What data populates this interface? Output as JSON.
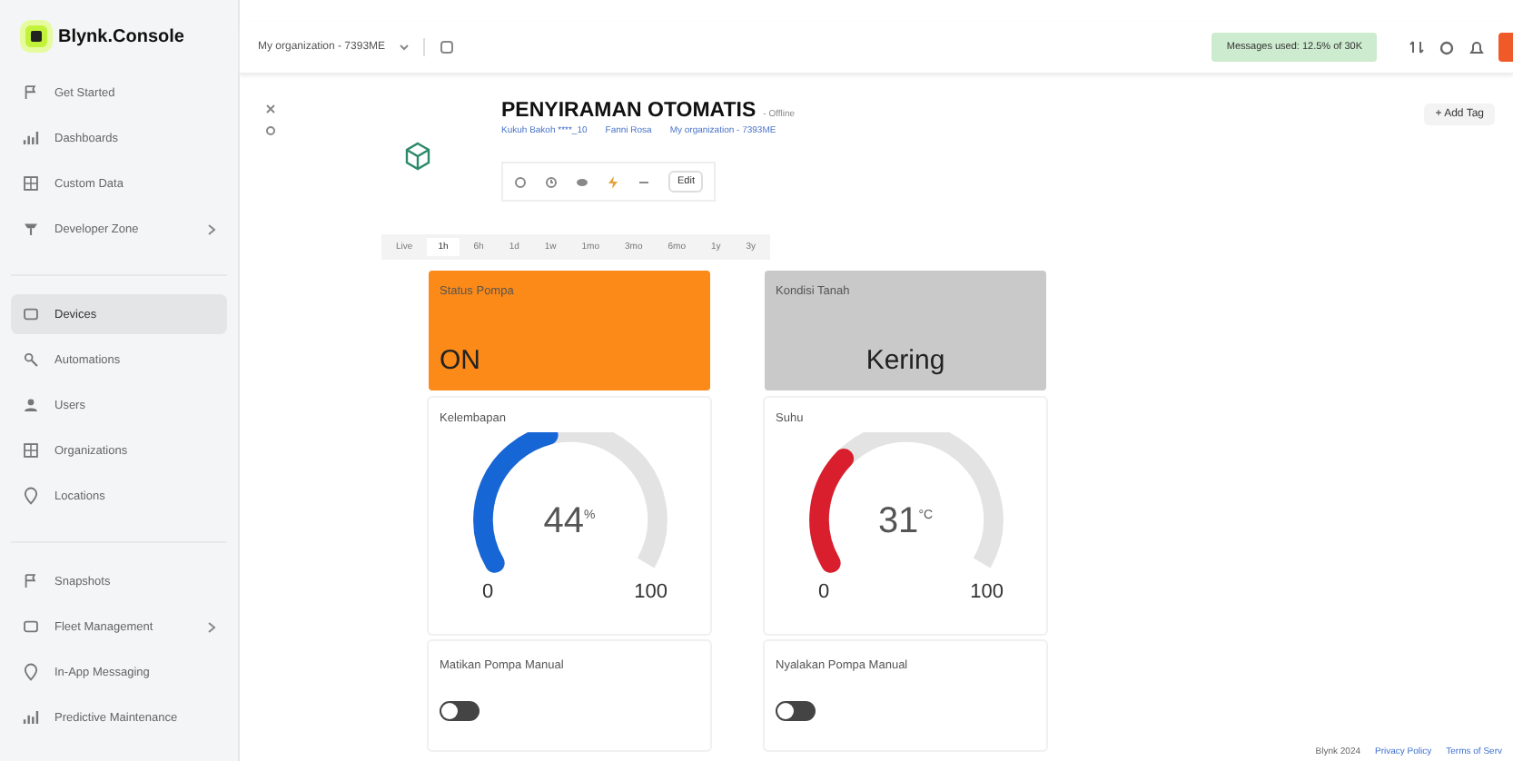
{
  "sidebar": {
    "logo": "Blynk.Console",
    "groups": [
      {
        "items": [
          {
            "label": "Get Started",
            "selected": false,
            "chevron": false
          },
          {
            "label": "Dashboards",
            "selected": false,
            "chevron": false
          },
          {
            "label": "Custom Data",
            "selected": false,
            "chevron": false
          },
          {
            "label": "Developer Zone",
            "selected": false,
            "chevron": true
          }
        ]
      },
      {
        "items": [
          {
            "label": "Devices",
            "selected": true,
            "chevron": false
          },
          {
            "label": "Automations",
            "selected": false,
            "chevron": false
          },
          {
            "label": "Users",
            "selected": false,
            "chevron": false
          },
          {
            "label": "Organizations",
            "selected": false,
            "chevron": false
          },
          {
            "label": "Locations",
            "selected": false,
            "chevron": false
          }
        ]
      },
      {
        "items": [
          {
            "label": "Snapshots",
            "selected": false,
            "chevron": false
          },
          {
            "label": "Fleet Management",
            "selected": false,
            "chevron": true
          },
          {
            "label": "In-App Messaging",
            "selected": false,
            "chevron": false
          },
          {
            "label": "Predictive Maintenance",
            "selected": false,
            "chevron": false
          }
        ]
      }
    ]
  },
  "topbar": {
    "organization": "My organization - 7393ME",
    "usage": "Messages used: 12.5% of 30K"
  },
  "device": {
    "title": "PENYIRAMAN OTOMATIS",
    "status": "- Offline",
    "meta": [
      "Kukuh Bakoh ****_10",
      "Fanni Rosa",
      "My organization - 7393ME"
    ],
    "edit": "Edit",
    "add_tag": "+ Add Tag",
    "time_ranges": [
      {
        "label": "Live",
        "selected": false
      },
      {
        "label": "1h",
        "selected": true
      },
      {
        "label": "6h",
        "selected": false
      },
      {
        "label": "1d",
        "selected": false
      },
      {
        "label": "1w",
        "selected": false
      },
      {
        "label": "1mo",
        "selected": false
      },
      {
        "label": "3mo",
        "selected": false
      },
      {
        "label": "6mo",
        "selected": false
      },
      {
        "label": "1y",
        "selected": false
      },
      {
        "label": "3y",
        "selected": false
      }
    ]
  },
  "widgets": [
    {
      "kind": "label",
      "title": "Status Pompa",
      "value": "ON",
      "color": "#fb8a18"
    },
    {
      "kind": "label",
      "title": "Kondisi Tanah",
      "value": "Kering",
      "color": "#c9c9c9"
    },
    {
      "kind": "gauge",
      "title": "Kelembapan",
      "value": "44",
      "unit": "%",
      "color": "#1766d6",
      "min": "0",
      "max": "100"
    },
    {
      "kind": "gauge",
      "title": "Suhu",
      "value": "31",
      "unit": "°C",
      "color": "#d91f2d",
      "min": "0",
      "max": "100"
    },
    {
      "kind": "switch",
      "title": "Matikan Pompa Manual",
      "on": false
    },
    {
      "kind": "switch",
      "title": "Nyalakan Pompa Manual",
      "on": false
    }
  ],
  "footer": {
    "copyright": "Blynk 2024",
    "links": [
      "Privacy Policy",
      "Terms of Serv"
    ]
  }
}
